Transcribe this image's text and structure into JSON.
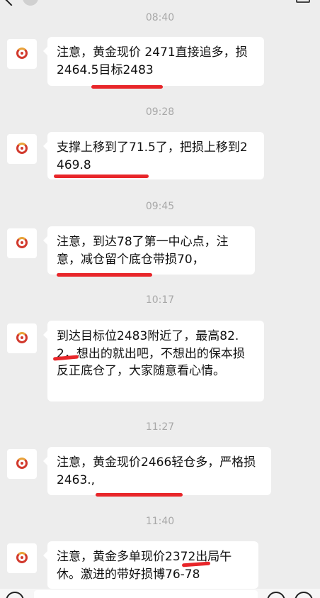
{
  "header": {
    "title": ""
  },
  "messages": [
    {
      "time": "08:40",
      "sender_avatar": "gold-trading-logo",
      "text": "注意，黄金现价 2471直接追多，损2464.5目标2483"
    },
    {
      "time": "09:28",
      "sender_avatar": "gold-trading-logo",
      "text": "支撑上移到了71.5了，把损上移到2469.8"
    },
    {
      "time": "09:45",
      "sender_avatar": "gold-trading-logo",
      "text": "注意，到达78了第一中心点，注意，减仓留个底仓带损70，"
    },
    {
      "time": "10:17",
      "sender_avatar": "gold-trading-logo",
      "text": "到达目标位2483附近了，最高82.2，想出的就出吧，不想出的保本损反正底仓了，大家随意看心情。"
    },
    {
      "time": "11:27",
      "sender_avatar": "gold-trading-logo",
      "text": "注意，黄金现价2466轻仓多，严格损2463.,"
    },
    {
      "time": "11:40",
      "sender_avatar": "gold-trading-logo",
      "text": "注意，黄金多单现价2372出局午休。激进的带好损博76-78"
    }
  ],
  "input": {
    "placeholder": ""
  },
  "colors": {
    "background": "#ededed",
    "bubble": "#ffffff",
    "annotation_underline": "#e8262a",
    "timestamp": "#a8a8a8"
  }
}
